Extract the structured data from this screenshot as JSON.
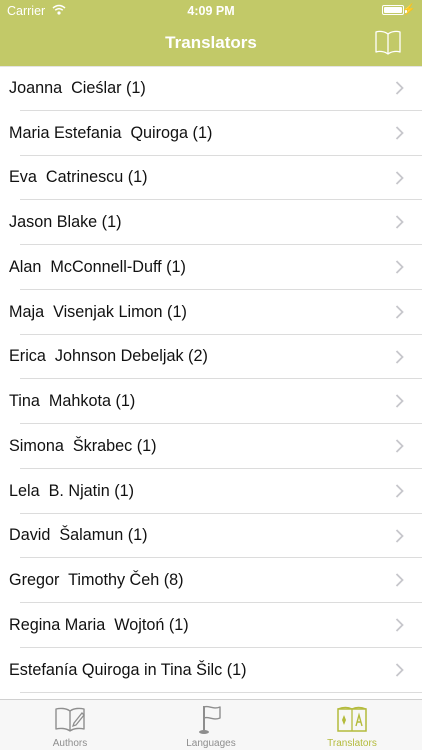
{
  "status": {
    "carrier": "Carrier",
    "time": "4:09 PM"
  },
  "header": {
    "title": "Translators",
    "right_icon": "book-icon"
  },
  "translators": [
    "Joanna  Cieślar (1)",
    "Maria Estefania  Quiroga (1)",
    "Eva  Catrinescu (1)",
    "Jason Blake (1)",
    "Alan  McConnell-Duff (1)",
    "Maja  Visenjak Limon (1)",
    "Erica  Johnson Debeljak (2)",
    "Tina  Mahkota (1)",
    "Simona  Škrabec (1)",
    "Lela  B. Njatin (1)",
    "David  Šalamun (1)",
    "Gregor  Timothy Čeh (8)",
    "Regina Maria  Wojtoń (1)",
    "Estefanía Quiroga in Tina Šilc (1)"
  ],
  "tabs": [
    {
      "label": "Authors",
      "icon": "open-book-pen-icon",
      "active": false
    },
    {
      "label": "Languages",
      "icon": "flag-icon",
      "active": false
    },
    {
      "label": "Translators",
      "icon": "translation-book-icon",
      "active": true
    }
  ],
  "colors": {
    "accent": "#c2c968",
    "active_tab": "#b4bb3c",
    "inactive_tab": "#8e8e8e"
  }
}
